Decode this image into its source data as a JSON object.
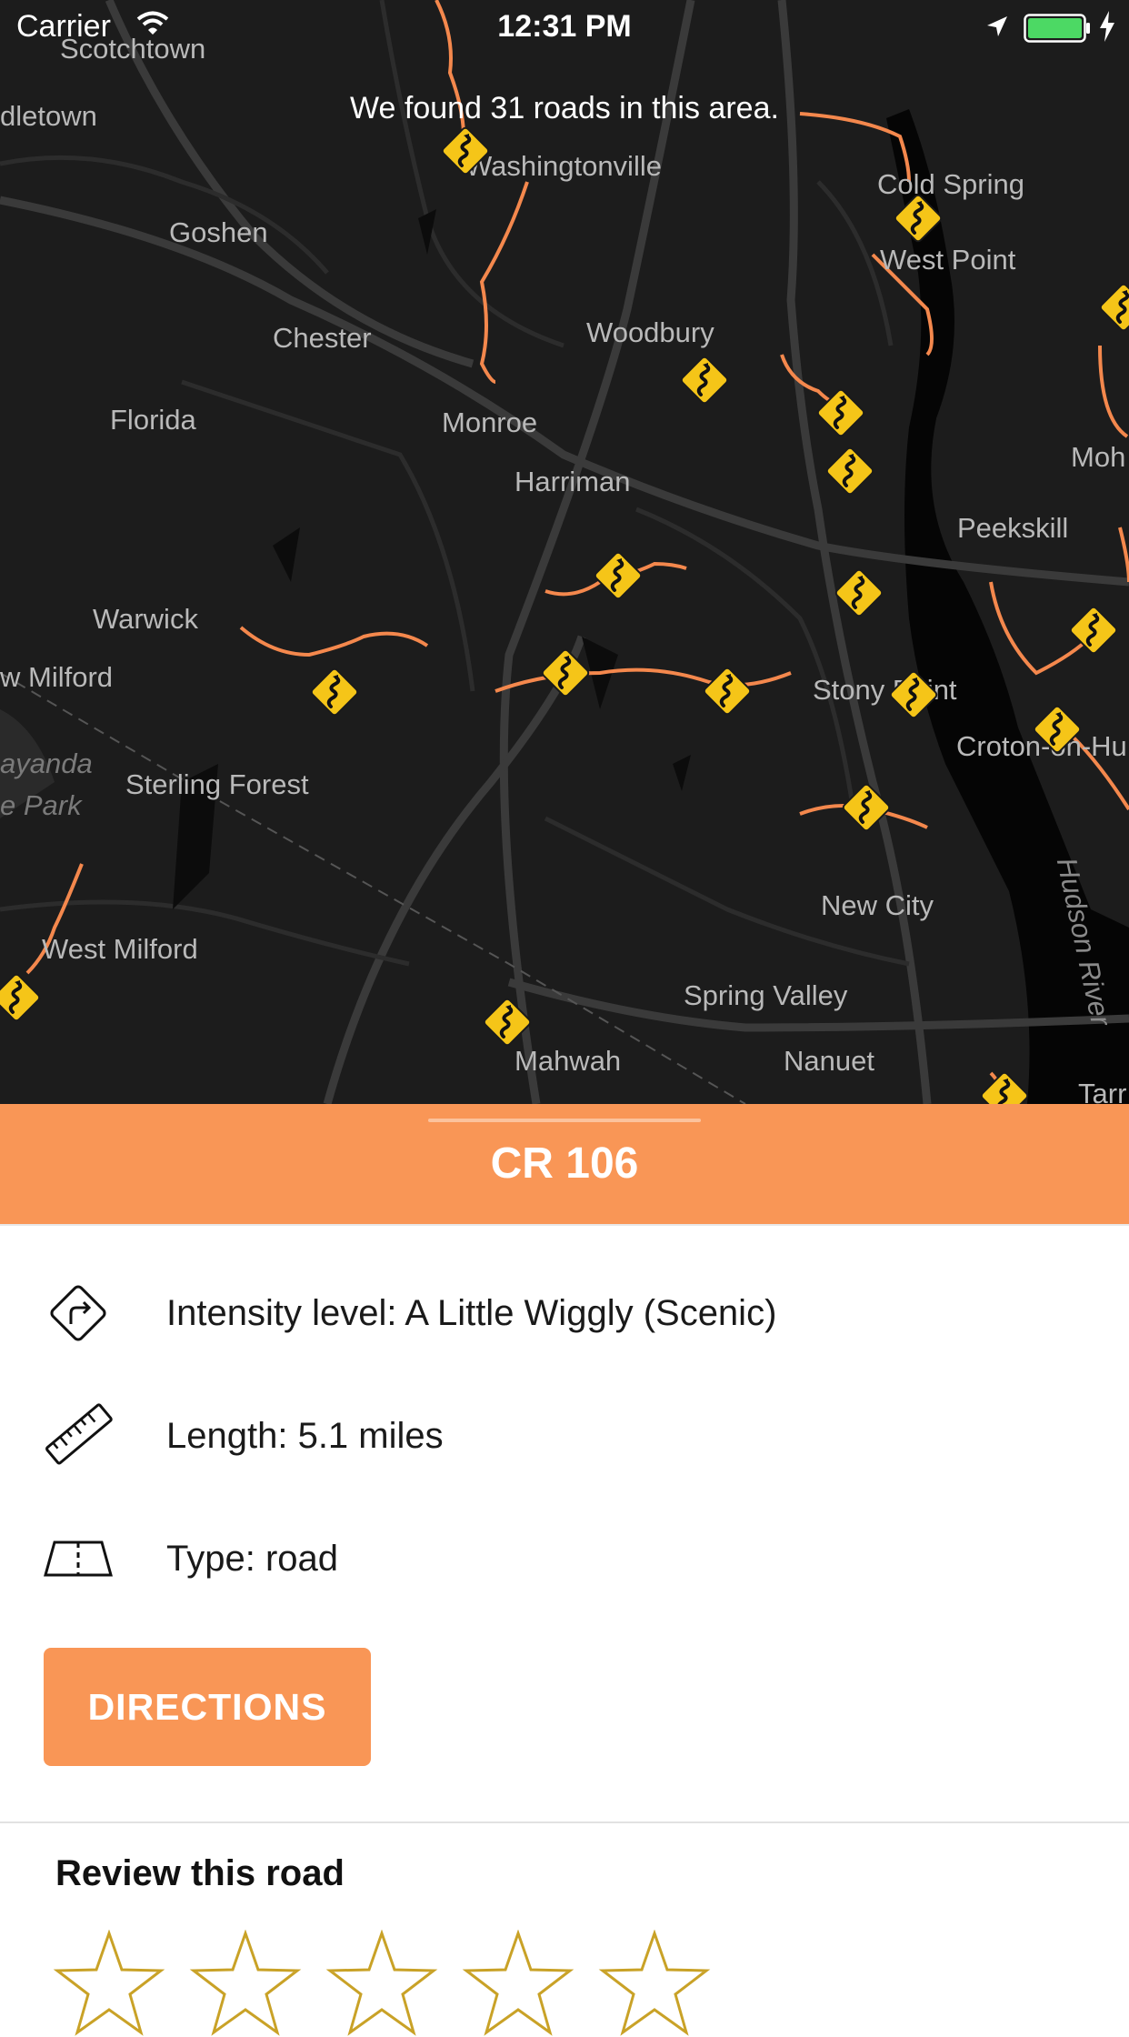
{
  "status_bar": {
    "carrier": "Carrier",
    "time": "12:31 PM",
    "icons": [
      "wifi-icon",
      "location-arrow-icon",
      "battery-icon",
      "charging-bolt-icon"
    ],
    "battery_color": "#4cd964"
  },
  "map": {
    "found_text": "We found 31 roads in this area.",
    "route_color": "#f4884d",
    "marker_color": "#f5c518",
    "places": [
      "Scotchtown",
      "dletown",
      "Washingtonville",
      "Cold Spring",
      "West Point",
      "Goshen",
      "Chester",
      "Woodbury",
      "Florida",
      "Monroe",
      "Harriman",
      "Moh",
      "Peekskill",
      "Warwick",
      "w Milford",
      "Stony Point",
      "Croton-on-Hu",
      "Sterling Forest",
      "ayanda",
      "e Park",
      "New City",
      "West Milford",
      "Spring Valley",
      "Mahwah",
      "Nanuet",
      "Hudson River",
      "Tarr"
    ]
  },
  "road": {
    "name": "CR 106",
    "details": [
      {
        "icon": "turn-sign-icon",
        "text": "Intensity level: A Little Wiggly (Scenic)"
      },
      {
        "icon": "ruler-icon",
        "text": "Length: 5.1 miles"
      },
      {
        "icon": "road-type-icon",
        "text": "Type: road"
      }
    ],
    "directions_label": "DIRECTIONS"
  },
  "review": {
    "title": "Review this road",
    "rating": 0,
    "max_rating": 5,
    "star_color": "#c9a227"
  }
}
